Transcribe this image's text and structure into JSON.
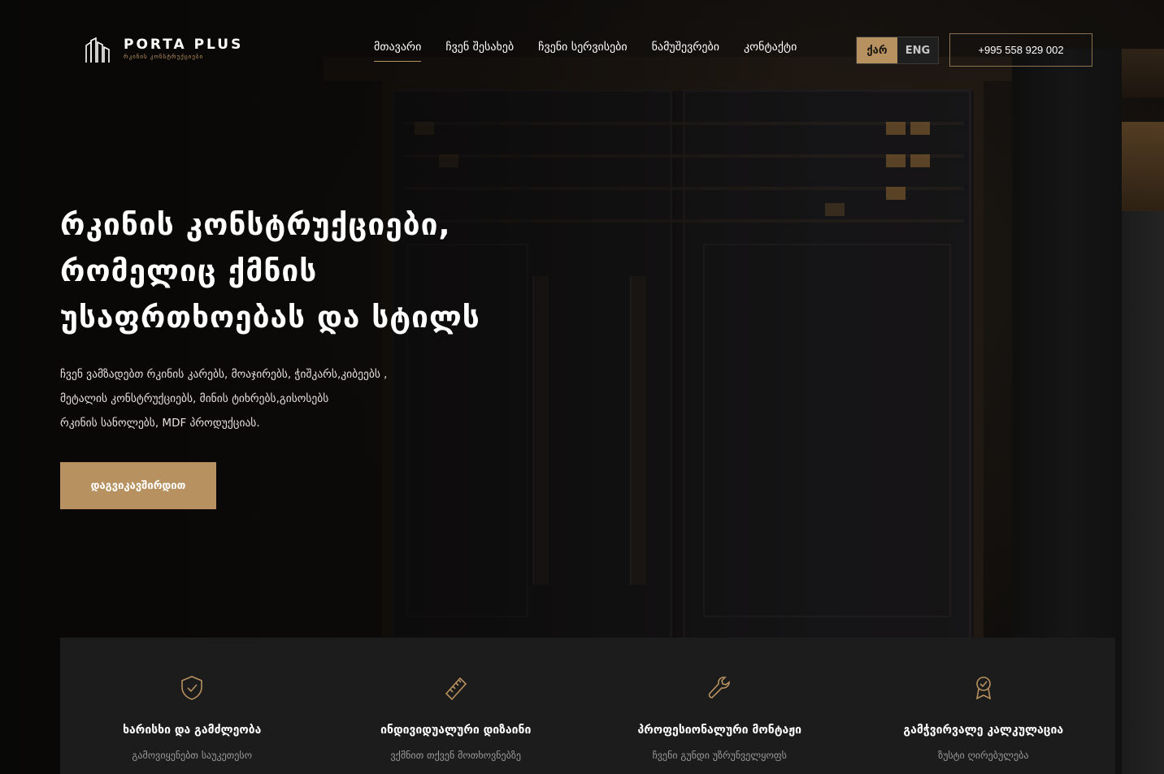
{
  "header": {
    "brand": "PORTA PLUS",
    "brand_sub": "რკინის კონსტრუქციები",
    "nav": [
      "მთავარი",
      "ჩვენ შესახებ",
      "ჩვენი სერვისები",
      "ნამუშევრები",
      "კონტაქტი"
    ],
    "lang": [
      "ქარ",
      "ENG"
    ],
    "phone": "+995 558 929 002"
  },
  "hero": {
    "title_lines": [
      "რკინის კონსტრუქციები,",
      "რომელიც ქმნის",
      "უსაფრთხოებას და სტილს"
    ],
    "desc_lines": [
      "ჩვენ ვამზადებთ რკინის კარებს, მოაჯირებს, ჭიშკარს,კიბეებს ,",
      "მეტალის კონსტრუქციებს, მინის ტიხრებს,გისოსებს",
      "რკინის სანოლებს, MDF პროდუქციას."
    ],
    "cta": "დაგვიკავშირდით"
  },
  "features": [
    {
      "icon": "shield-check-icon",
      "title": "ხარისხი და გამძლეობა",
      "text": "გამოვიყენებთ საუკეთესო"
    },
    {
      "icon": "ruler-icon",
      "title": "ინდივიდუალური დიზაინი",
      "text": "ვქმნით თქვენ მოთხოვნებზე"
    },
    {
      "icon": "wrench-icon",
      "title": "პროფესიონალური მონტაჟი",
      "text": "ჩვენი გუნდი უზრუნველყოფს"
    },
    {
      "icon": "award-icon",
      "title": "გამჭვირვალე კალკულაცია",
      "text": "ზუსტი ღირებულება"
    }
  ],
  "colors": {
    "accent": "#b7915f",
    "panel": "#1c1c1c",
    "background": "#0e0d0c"
  }
}
